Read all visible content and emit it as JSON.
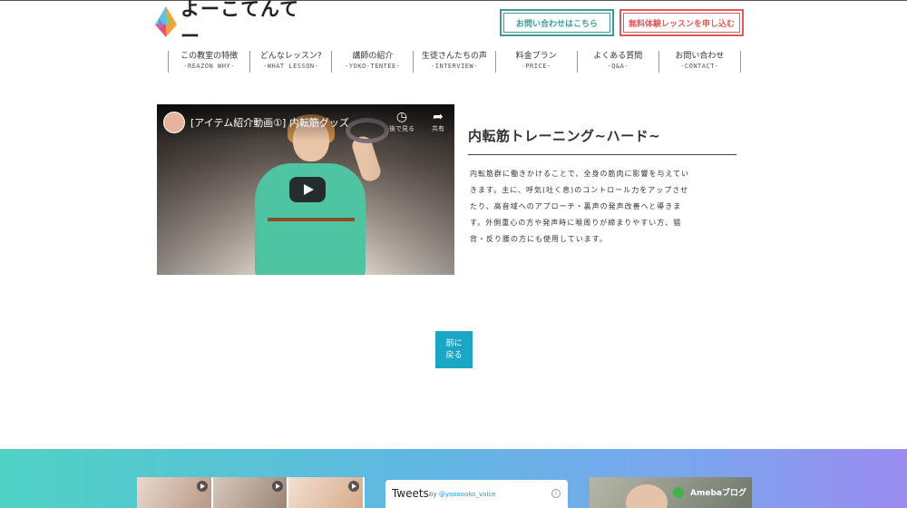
{
  "header": {
    "logo_text": "よーこてんてー",
    "contact_button": "お問い合わせはこちら",
    "trial_button": "無料体験レッスンを申し込む"
  },
  "nav": [
    {
      "jp": "この教室の特徴",
      "en": "-REAZON WHY-"
    },
    {
      "jp": "どんなレッスン?",
      "en": "-WHAT LESSON-"
    },
    {
      "jp": "講師の紹介",
      "en": "-YOKO-TENTEE-"
    },
    {
      "jp": "生徒さんたちの声",
      "en": "-INTERVIEW-"
    },
    {
      "jp": "料金プラン",
      "en": "-PRICE-"
    },
    {
      "jp": "よくある質問",
      "en": "-Q&A-"
    },
    {
      "jp": "お問い合わせ",
      "en": "-CONTACT-"
    }
  ],
  "video": {
    "title": "[アイテム紹介動画①] 内転筋グッズ",
    "watch_later": "後で見る",
    "share": "共有"
  },
  "article": {
    "title": "内転筋トレーニング~ハード~",
    "body": "内転筋群に働きかけることで、全身の筋肉に影響を与えていきます。主に、呼気(吐く息)のコントロール力をアップさせたり、高音域へのアプローチ・裏声の発声改善へと導きます。外側重心の方や発声時に喉周りが締まりやすい方、猫背・反り腰の方にも使用しています。"
  },
  "back_button": {
    "line1": "前に",
    "line2": "戻る"
  },
  "footer": {
    "tweets_title": "Tweets",
    "tweets_by_prefix": "by ",
    "tweets_handle": "@yoooooko_voice",
    "ameba_label": "Amebaブログ"
  },
  "colors": {
    "contact_accent": "#3c9c98",
    "trial_accent": "#e05a5a",
    "back_button": "#1aa6c4"
  }
}
